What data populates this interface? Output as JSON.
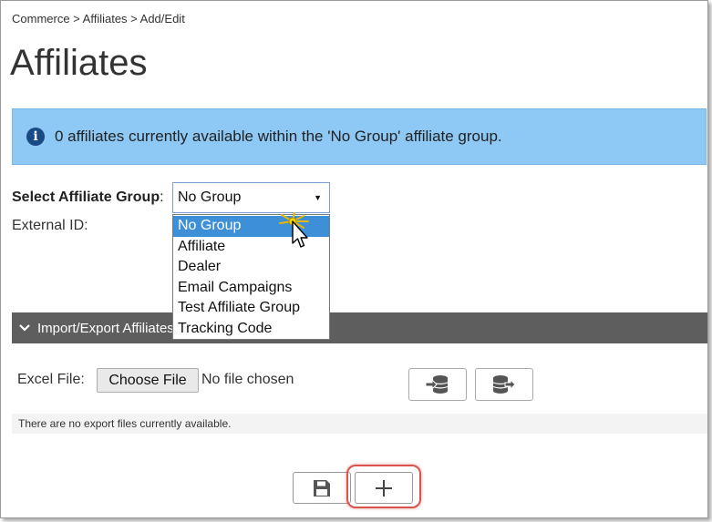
{
  "breadcrumb": "Commerce > Affiliates > Add/Edit",
  "page_title": "Affiliates",
  "info_banner": {
    "icon": "info-circle-icon",
    "text": "0 affiliates currently available within the 'No Group' affiliate group."
  },
  "form": {
    "group_label": "Select Affiliate Group",
    "group_label_colon": ":",
    "external_id_label": "External ID:",
    "selected_group": "No Group",
    "group_options": [
      "No Group",
      "Affiliate",
      "Dealer",
      "Email Campaigns",
      "Test Affiliate Group",
      "Tracking Code"
    ]
  },
  "import_export": {
    "section_title": "Import/Export Affiliates",
    "excel_label": "Excel File:",
    "choose_file_label": "Choose File",
    "no_file_text": "No file chosen",
    "note": "There are no export files currently available.",
    "import_icon": "database-import-icon",
    "export_icon": "database-export-icon"
  },
  "actions": {
    "save_icon": "floppy-disk-icon",
    "add_icon": "plus-icon",
    "highlight_color": "#d9534f"
  },
  "colors": {
    "banner_bg": "#8ec8f4",
    "section_bar": "#5e5e5e",
    "selected_option": "#3d8fd8"
  }
}
